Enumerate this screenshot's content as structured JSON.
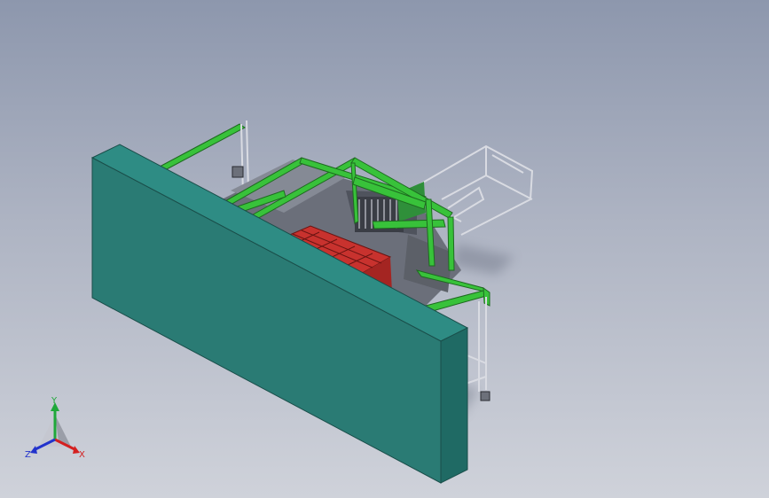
{
  "viewport": {
    "background_top": "#8d97ad",
    "background_bottom": "#cfd2da"
  },
  "model": {
    "wall_color": "#2a7b74",
    "frame_color": "#38c23a",
    "rack_color": "#c8322e",
    "steel_color": "#c9ccd4"
  },
  "triad": {
    "x_label": "X",
    "y_label": "Y",
    "z_label": "Z",
    "x_color": "#d42020",
    "y_color": "#1fa83a",
    "z_color": "#2233cc"
  }
}
